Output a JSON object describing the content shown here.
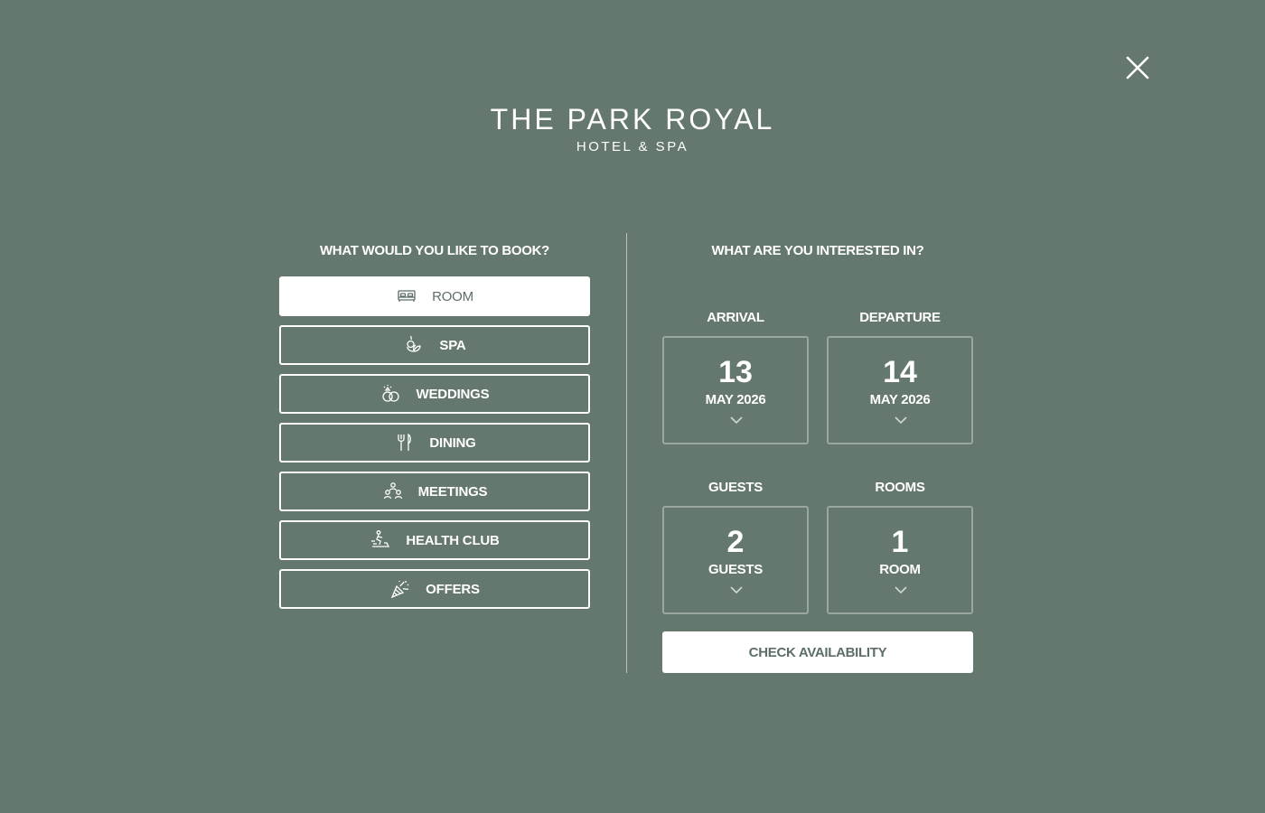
{
  "colors": {
    "background": "#65786e",
    "foreground": "#ffffff",
    "active_text": "#5c6e66"
  },
  "header": {
    "close_icon": "close-icon",
    "logo_main": "THE PARK ROYAL",
    "logo_sub": "HOTEL & SPA"
  },
  "book": {
    "heading": "WHAT WOULD YOU LIKE TO BOOK?",
    "items": [
      {
        "label": "ROOM",
        "icon": "bed-icon",
        "active": true
      },
      {
        "label": "SPA",
        "icon": "spa-icon",
        "active": false
      },
      {
        "label": "WEDDINGS",
        "icon": "rings-icon",
        "active": false
      },
      {
        "label": "DINING",
        "icon": "cutlery-icon",
        "active": false
      },
      {
        "label": "MEETINGS",
        "icon": "meeting-icon",
        "active": false
      },
      {
        "label": "HEALTH CLUB",
        "icon": "rowing-icon",
        "active": false
      },
      {
        "label": "OFFERS",
        "icon": "party-popper-icon",
        "active": false
      }
    ]
  },
  "interest": {
    "heading": "WHAT ARE YOU INTERESTED IN?",
    "arrival": {
      "label": "ARRIVAL",
      "value": "13",
      "sub": "MAY 2026"
    },
    "departure": {
      "label": "DEPARTURE",
      "value": "14",
      "sub": "MAY 2026"
    },
    "guests": {
      "label": "GUESTS",
      "value": "2",
      "sub": "GUESTS"
    },
    "rooms": {
      "label": "ROOMS",
      "value": "1",
      "sub": "ROOM"
    },
    "check_label": "CHECK AVAILABILITY"
  }
}
